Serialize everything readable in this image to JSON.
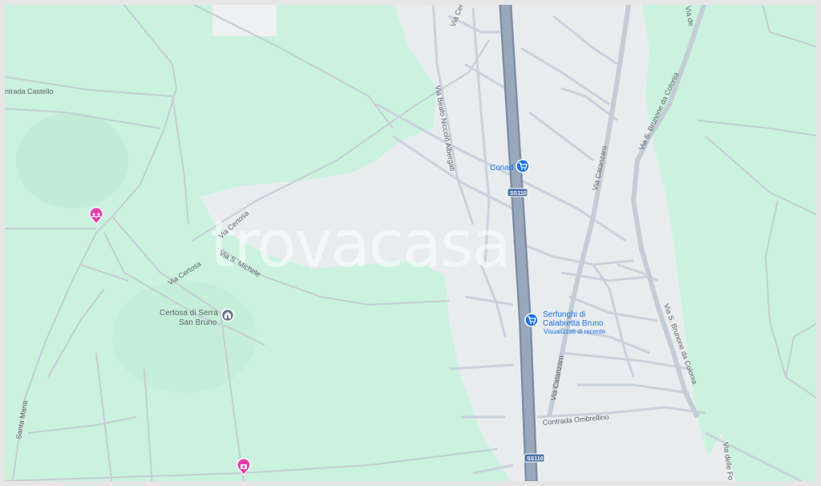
{
  "map": {
    "watermark": "trovacasa",
    "streets": {
      "via_certosa_top": "Via Certosa",
      "via_beato": "Via Beato Niccolò Albergati",
      "contrada_castello": "ntrada Castello",
      "via_certosa_mid": "Via Certosa",
      "via_certosa_low": "Via Certosa",
      "via_s_michele": "Via S. Michele",
      "via_catanzaro_top": "Via Catanzaro",
      "via_catanzaro_low": "Via Catanzaro",
      "via_s_brunone_top": "Via S. Brunone da Colonia",
      "via_s_brunone_low": "Via S. Brunone da Colonia",
      "contrada_ombrellino": "Contrada Ombrellino",
      "santa_maria": "Santa Maria",
      "via_delle_fo": "Via delle Fo",
      "via_top_right": "Via de"
    },
    "pois": {
      "conad": "Conad",
      "serfunghi_line1": "Serfunghi di",
      "serfunghi_line2": "Calabretta Bruno",
      "serfunghi_sub": "Visualizzati di recente",
      "certosa_line1": "Certosa di Serra",
      "certosa_line2": "San Bruno"
    },
    "road_shields": {
      "upper": "SS110",
      "lower": "SS110"
    },
    "colors": {
      "urban": "#e9ecef",
      "park": "#cbf2df",
      "road": "#c9d1dc",
      "highway": "#8f9fb5",
      "poi_blue": "#1a73e8",
      "poi_pink": "#e53dad",
      "poi_gray": "#6b7785"
    },
    "icons": {
      "shop_poi": "shopping-cart-icon",
      "monument_poi": "monument-icon",
      "pink_poi_1": "community-icon",
      "pink_poi_2": "camera-icon"
    }
  }
}
